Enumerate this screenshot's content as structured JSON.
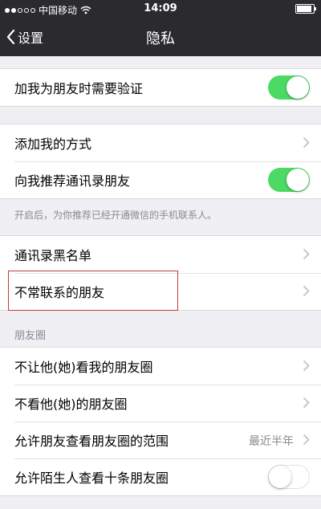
{
  "status_bar": {
    "carrier": "中国移动",
    "time": "14:09",
    "signal_bars": 2
  },
  "nav": {
    "back_label": "设置",
    "title": "隐私"
  },
  "group1": {
    "verify_label": "加我为朋友时需要验证",
    "verify_on": true
  },
  "group2": {
    "add_method_label": "添加我的方式",
    "recommend_label": "向我推荐通讯录朋友",
    "recommend_on": true,
    "hint": "开启后，为你推荐已经开通微信的手机联系人。"
  },
  "group3": {
    "blacklist_label": "通讯录黑名单",
    "infrequent_label": "不常联系的朋友"
  },
  "moments": {
    "header": "朋友圈",
    "block_label": "不让他(她)看我的朋友圈",
    "hide_label": "不看他(她)的朋友圈",
    "range_label": "允许朋友查看朋友圈的范围",
    "range_value": "最近半年",
    "stranger_label": "允许陌生人查看十条朋友圈",
    "stranger_on": false
  },
  "colors": {
    "switch_on": "#4cd964",
    "nav_bg": "#2b2b2f",
    "highlight": "#c63a3a"
  }
}
